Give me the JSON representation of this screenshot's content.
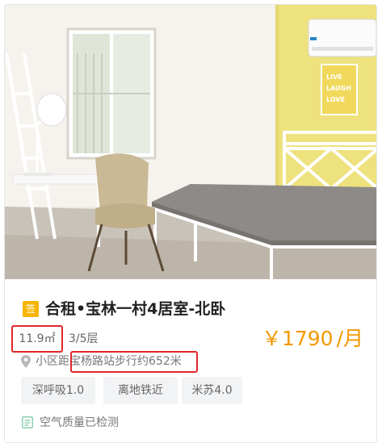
{
  "listing": {
    "sign_badge": "签",
    "title": "合租•宝林一村4居室-北卧",
    "area": "11.9㎡",
    "floor": "3/5层",
    "price": "￥1790",
    "price_unit": "/月",
    "location_prefix": "小区距",
    "location_text": "宝杨路站步行约652米",
    "tags": [
      "深呼吸1.0",
      "离地铁近",
      "米苏4.0"
    ],
    "air_quality": "空气质量已检测"
  },
  "photo": {
    "poster_lines": [
      "LIVE",
      "LAUGH",
      "LOVE"
    ]
  },
  "colors": {
    "price": "#f39800",
    "badge": "#f7b500",
    "highlight": "#e0282a",
    "tag_bg": "#f2f3f5",
    "wall_yellow": "#eee27e"
  }
}
